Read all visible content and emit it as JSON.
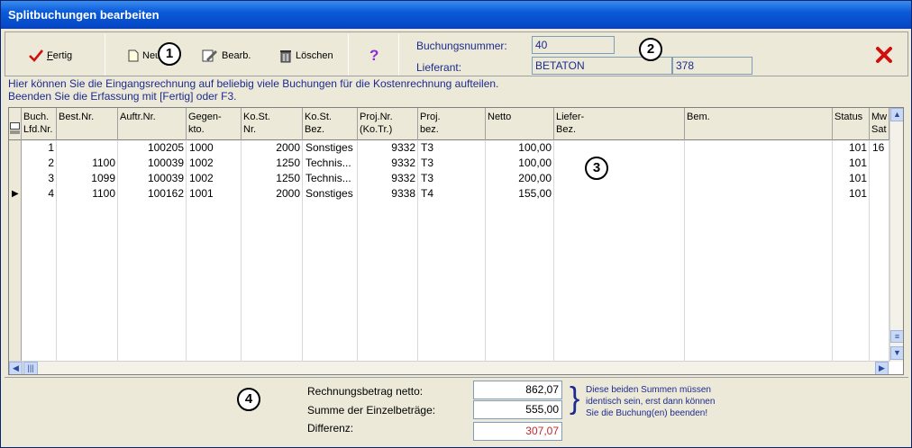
{
  "window": {
    "title": "Splitbuchungen bearbeiten"
  },
  "toolbar": {
    "fertig_accel": "F",
    "fertig_rest": "ertig",
    "neu_label": "Neu",
    "bearb_label": "Bearb.",
    "loeschen_label": "Löschen",
    "help_glyph": "?",
    "buchungsnummer_label": "Buchungsnummer:",
    "buchungsnummer_value": "40",
    "lieferant_label": "Lieferant:",
    "lieferant_name": "BETATON",
    "lieferant_nr": "378"
  },
  "badges": [
    "1",
    "2",
    "3",
    "4"
  ],
  "info": {
    "line1": "Hier können Sie die Eingangsrechnung auf beliebig viele Buchungen für die Kostenrechnung aufteilen.",
    "line2": "Beenden Sie die Erfassung mit [Fertig] oder F3."
  },
  "grid": {
    "columns": [
      {
        "key": "lfd",
        "label": "Buch.\nLfd.Nr."
      },
      {
        "key": "best",
        "label": "Best.Nr."
      },
      {
        "key": "auftr",
        "label": "Auftr.Nr."
      },
      {
        "key": "gegen",
        "label": "Gegen-\nkto."
      },
      {
        "key": "kost",
        "label": "Ko.St.\nNr."
      },
      {
        "key": "kostbez",
        "label": "Ko.St.\nBez."
      },
      {
        "key": "proj",
        "label": "Proj.Nr.\n(Ko.Tr.)"
      },
      {
        "key": "projbez",
        "label": "Proj.\nbez."
      },
      {
        "key": "netto",
        "label": "Netto"
      },
      {
        "key": "liefer",
        "label": "Liefer-\nBez."
      },
      {
        "key": "bem",
        "label": "Bem."
      },
      {
        "key": "status",
        "label": "Status"
      },
      {
        "key": "mwst",
        "label": "Mw\nSat"
      }
    ],
    "rows": [
      {
        "lfd": "1",
        "best": "",
        "auftr": "100205",
        "gegen": "1000",
        "kost": "2000",
        "kostbez": "Sonstiges",
        "proj": "9332",
        "projbez": "T3",
        "netto": "100,00",
        "liefer": "",
        "bem": "",
        "status": "101",
        "mwst": "16"
      },
      {
        "lfd": "2",
        "best": "1100",
        "auftr": "100039",
        "gegen": "1002",
        "kost": "1250",
        "kostbez": "Technis...",
        "proj": "9332",
        "projbez": "T3",
        "netto": "100,00",
        "liefer": "",
        "bem": "",
        "status": "101",
        "mwst": ""
      },
      {
        "lfd": "3",
        "best": "1099",
        "auftr": "100039",
        "gegen": "1002",
        "kost": "1250",
        "kostbez": "Technis...",
        "proj": "9332",
        "projbez": "T3",
        "netto": "200,00",
        "liefer": "",
        "bem": "",
        "status": "101",
        "mwst": ""
      },
      {
        "lfd": "4",
        "best": "1100",
        "auftr": "100162",
        "gegen": "1001",
        "kost": "2000",
        "kostbez": "Sonstiges",
        "proj": "9338",
        "projbez": "T4",
        "netto": "155,00",
        "liefer": "",
        "bem": "",
        "status": "101",
        "mwst": ""
      }
    ],
    "current_row": 3
  },
  "footer": {
    "netto_label": "Rechnungsbetrag netto:",
    "netto_value": "862,07",
    "summe_label": "Summe der Einzelbeträge:",
    "summe_value": "555,00",
    "differenz_label": "Differenz:",
    "differenz_value": "307,07",
    "note_line1": "Diese beiden Summen müssen",
    "note_line2": "identisch sein, erst dann können",
    "note_line3": "Sie die Buchung(en) beenden!"
  },
  "colors": {
    "accent_blue": "#1C2B8F",
    "diff_red": "#C0282B",
    "close_red": "#D01010"
  }
}
